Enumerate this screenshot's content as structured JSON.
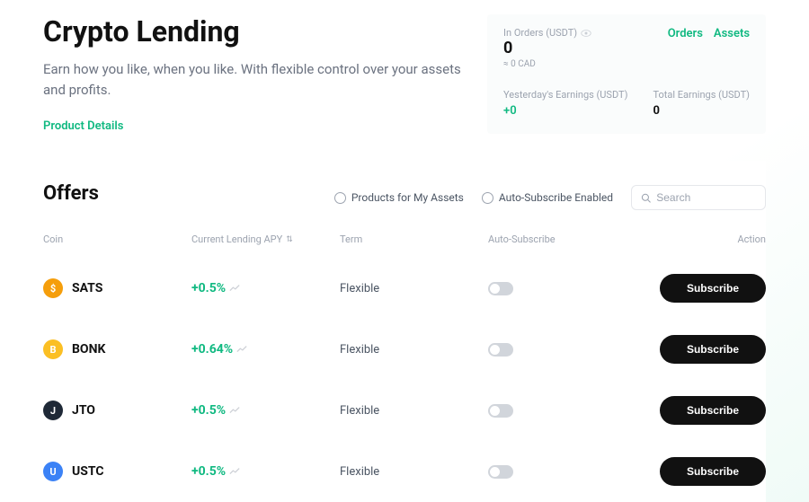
{
  "hero": {
    "title": "Crypto Lending",
    "subtitle": "Earn how you like, when you like. With flexible control over your assets and profits.",
    "product_details": "Product Details"
  },
  "stats": {
    "in_orders_label": "In Orders (USDT)",
    "in_orders_value": "0",
    "approx": "≈ 0 CAD",
    "orders_link": "Orders",
    "assets_link": "Assets",
    "yesterday_label": "Yesterday's Earnings (USDT)",
    "yesterday_value": "+0",
    "total_label": "Total Earnings (USDT)",
    "total_value": "0"
  },
  "offers": {
    "title": "Offers",
    "filter_my_assets": "Products for My Assets",
    "filter_auto": "Auto-Subscribe Enabled",
    "search_placeholder": "Search",
    "columns": {
      "coin": "Coin",
      "apy": "Current Lending APY",
      "term": "Term",
      "auto": "Auto-Subscribe",
      "action": "Action"
    },
    "subscribe_label": "Subscribe",
    "rows": [
      {
        "symbol": "SATS",
        "apy": "+0.5%",
        "term": "Flexible",
        "icon_bg": "#f59e0b",
        "icon_letter": "$"
      },
      {
        "symbol": "BONK",
        "apy": "+0.64%",
        "term": "Flexible",
        "icon_bg": "#fbbf24",
        "icon_letter": "B"
      },
      {
        "symbol": "JTO",
        "apy": "+0.5%",
        "term": "Flexible",
        "icon_bg": "#1f2937",
        "icon_letter": "J"
      },
      {
        "symbol": "USTC",
        "apy": "+0.5%",
        "term": "Flexible",
        "icon_bg": "#3b82f6",
        "icon_letter": "U"
      }
    ]
  }
}
